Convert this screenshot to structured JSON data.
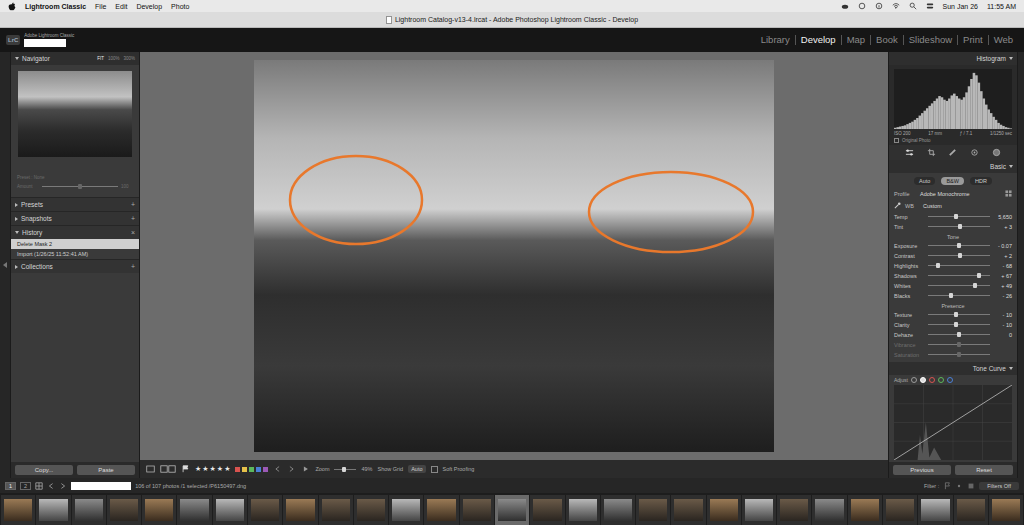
{
  "menubar": {
    "app_menus": [
      "Lightroom Classic",
      "File",
      "Edit",
      "Develop",
      "Photo"
    ],
    "date": "Sun Jan 26",
    "time": "11:55 AM"
  },
  "window": {
    "title": "Lightroom Catalog-v13-4.lrcat - Adobe Photoshop Lightroom Classic - Develop"
  },
  "identity": {
    "logo": "LrC",
    "product": "Adobe Lightroom Classic"
  },
  "modules": [
    {
      "label": "Library",
      "selected": false
    },
    {
      "label": "Develop",
      "selected": true
    },
    {
      "label": "Map",
      "selected": false
    },
    {
      "label": "Book",
      "selected": false
    },
    {
      "label": "Slideshow",
      "selected": false
    },
    {
      "label": "Print",
      "selected": false
    },
    {
      "label": "Web",
      "selected": false
    }
  ],
  "navigator": {
    "title": "Navigator",
    "zoom_options": [
      {
        "label": "FIT",
        "selected": true
      },
      {
        "label": "100%",
        "selected": false
      },
      {
        "label": "300%",
        "selected": false
      }
    ]
  },
  "preset_amount": {
    "preset": "Preset : None",
    "label": "Amount",
    "reading": "100",
    "level": 0.5,
    "disabled": true
  },
  "left_panels": [
    {
      "title": "Presets",
      "expanded": false,
      "action": "+",
      "items": []
    },
    {
      "title": "Snapshots",
      "expanded": false,
      "action": "+",
      "items": []
    },
    {
      "title": "History",
      "expanded": true,
      "action": "×",
      "items": [
        {
          "label": "Delete Mask 2",
          "selected": true
        },
        {
          "label": "Import (1/26/25 11:52:41 AM)",
          "selected": false
        }
      ]
    },
    {
      "title": "Collections",
      "expanded": false,
      "action": "+",
      "items": []
    }
  ],
  "left_buttons": [
    "Copy...",
    "Paste"
  ],
  "toolbar": {
    "stars": 5,
    "star_glyph": "★",
    "color_labels": [
      {
        "color": "#d9534f"
      },
      {
        "color": "#e6c14a"
      },
      {
        "color": "#5cb85c"
      },
      {
        "color": "#4a7fd6"
      },
      {
        "color": "#9b59b6"
      }
    ],
    "zoom_label": "Zoom",
    "zoom_level": 0.45,
    "zoom_reading": "49%",
    "grid_label": "Show Grid",
    "grid_value": "Auto",
    "soft_proofing": {
      "label": "Soft Proofing",
      "checked": false
    }
  },
  "histogram": {
    "title": "Histogram",
    "values": [
      2,
      3,
      4,
      5,
      6,
      8,
      10,
      12,
      15,
      18,
      22,
      26,
      30,
      34,
      38,
      42,
      46,
      50,
      54,
      52,
      48,
      46,
      50,
      55,
      58,
      54,
      50,
      48,
      52,
      60,
      70,
      82,
      92,
      88,
      76,
      62,
      50,
      40,
      32,
      26,
      20,
      15,
      10,
      7,
      5,
      3,
      2,
      1
    ],
    "info": [
      "ISO 200",
      "17 mm",
      "ƒ / 7.1",
      "1/1250 sec"
    ],
    "original_photo": {
      "label": "Original Photo",
      "checked": false
    }
  },
  "basic": {
    "title": "Basic",
    "treatment": [
      {
        "label": "Auto",
        "selected": false
      },
      {
        "label": "B&W",
        "selected": true
      },
      {
        "label": "HDR",
        "selected": false
      }
    ],
    "profile": {
      "label": "Profile",
      "value": "Adobe Monochrome"
    },
    "wb": {
      "label": "WB",
      "value": "Custom"
    },
    "groups": [
      {
        "sliders": [
          {
            "label": "Temp",
            "reading": "5,650",
            "level": 0.45,
            "disabled": false
          },
          {
            "label": "Tint",
            "reading": "+ 3",
            "level": 0.51,
            "disabled": false
          }
        ]
      },
      {
        "title": "Tone",
        "sliders": [
          {
            "label": "Exposure",
            "reading": "- 0.07",
            "level": 0.5,
            "disabled": false
          },
          {
            "label": "Contrast",
            "reading": "+ 2",
            "level": 0.51,
            "disabled": false
          },
          {
            "label": "Highlights",
            "reading": "- 68",
            "level": 0.16,
            "disabled": false
          },
          {
            "label": "Shadows",
            "reading": "+ 67",
            "level": 0.83,
            "disabled": false
          },
          {
            "label": "Whites",
            "reading": "+ 49",
            "level": 0.75,
            "disabled": false
          },
          {
            "label": "Blacks",
            "reading": "- 26",
            "level": 0.37,
            "disabled": false
          }
        ]
      },
      {
        "title": "Presence",
        "sliders": [
          {
            "label": "Texture",
            "reading": "- 10",
            "level": 0.45,
            "disabled": false
          },
          {
            "label": "Clarity",
            "reading": "- 10",
            "level": 0.45,
            "disabled": false
          },
          {
            "label": "Dehaze",
            "reading": "0",
            "level": 0.5,
            "disabled": false
          },
          {
            "label": "Vibrance",
            "level": 0.5,
            "disabled": true
          },
          {
            "label": "Saturation",
            "level": 0.5,
            "disabled": true
          }
        ]
      }
    ]
  },
  "tone_curve": {
    "title": "Tone Curve",
    "adjust": "Adjust",
    "channels": [
      {
        "color": "#9a9a9a",
        "selected": false
      },
      {
        "color": "#ffffff",
        "selected": true
      },
      {
        "color": "#d9534f",
        "selected": false
      },
      {
        "color": "#5cb85c",
        "selected": false
      },
      {
        "color": "#4a7fd6",
        "selected": false
      }
    ]
  },
  "right_buttons": [
    "Previous",
    "Reset"
  ],
  "filmstrip": {
    "pages": [
      {
        "label": "1",
        "selected": true
      },
      {
        "label": "2",
        "selected": false
      }
    ],
    "status": "106 of 107 photos /1 selected /P6150497.dng",
    "filter_label": "Filter :",
    "filter_value": "Filters Off",
    "thumbnails": [
      {
        "selected": false
      },
      {
        "selected": false
      },
      {
        "selected": false
      },
      {
        "selected": false
      },
      {
        "selected": false
      },
      {
        "selected": false
      },
      {
        "selected": false
      },
      {
        "selected": false
      },
      {
        "selected": false
      },
      {
        "selected": false
      },
      {
        "selected": false
      },
      {
        "selected": false
      },
      {
        "selected": false
      },
      {
        "selected": false
      },
      {
        "selected": true
      },
      {
        "selected": false
      },
      {
        "selected": false
      },
      {
        "selected": false
      },
      {
        "selected": false
      },
      {
        "selected": false
      },
      {
        "selected": false
      },
      {
        "selected": false
      },
      {
        "selected": false
      },
      {
        "selected": false
      },
      {
        "selected": false
      },
      {
        "selected": false
      },
      {
        "selected": false
      },
      {
        "selected": false
      },
      {
        "selected": false
      }
    ]
  }
}
